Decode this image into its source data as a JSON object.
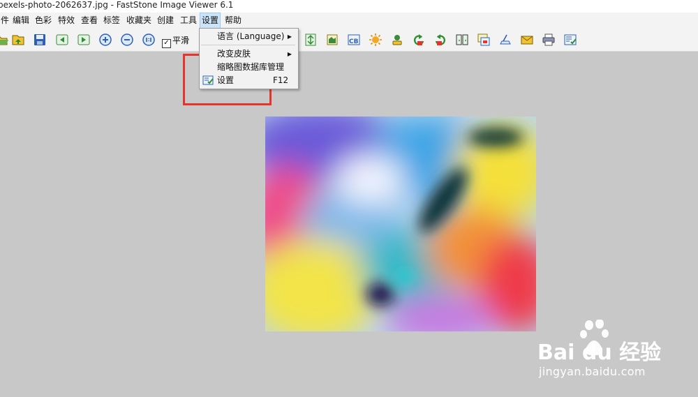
{
  "window": {
    "title": "pexels-photo-2062637.jpg  -  FastStone Image Viewer 6.1"
  },
  "menubar": {
    "items": [
      {
        "label": "件",
        "active": false
      },
      {
        "label": "编辑",
        "active": false
      },
      {
        "label": "色彩",
        "active": false
      },
      {
        "label": "特效",
        "active": false
      },
      {
        "label": "查看",
        "active": false
      },
      {
        "label": "标签",
        "active": false
      },
      {
        "label": "收藏夹",
        "active": false
      },
      {
        "label": "创建",
        "active": false
      },
      {
        "label": "工具",
        "active": false
      },
      {
        "label": "设置",
        "active": true
      },
      {
        "label": "帮助",
        "active": false
      }
    ]
  },
  "toolbar": {
    "smooth_label": "平滑",
    "smooth_checked": true,
    "left_icons": [
      "open-folder-icon",
      "browse-icon",
      "save-icon",
      "previous-icon",
      "next-icon",
      "zoom-in-icon",
      "zoom-out-icon",
      "actual-size-icon"
    ],
    "right_icons": [
      "resize-icon",
      "crop-icon",
      "contrast-icon",
      "brightness-icon",
      "stamp-icon",
      "rotate-left-icon",
      "rotate-right-icon",
      "compare-icon",
      "slideshow-icon",
      "scanner-icon",
      "email-icon",
      "print-icon",
      "settings-icon"
    ]
  },
  "settings_menu": {
    "items": [
      {
        "label": "语言 (Language)",
        "submenu": true,
        "shortcut": ""
      },
      {
        "label": "改变皮肤",
        "submenu": true,
        "shortcut": ""
      },
      {
        "label": "缩略图数据库管理",
        "submenu": false,
        "shortcut": ""
      },
      {
        "label": "设置",
        "submenu": false,
        "shortcut": "F12"
      }
    ]
  },
  "watermark": {
    "brand": "Bai du 经验",
    "url": "jingyan.baidu.com"
  },
  "colors": {
    "accent_red": "#e8332d",
    "menu_active": "#cce4f7",
    "workspace": "#c8c8c8"
  }
}
